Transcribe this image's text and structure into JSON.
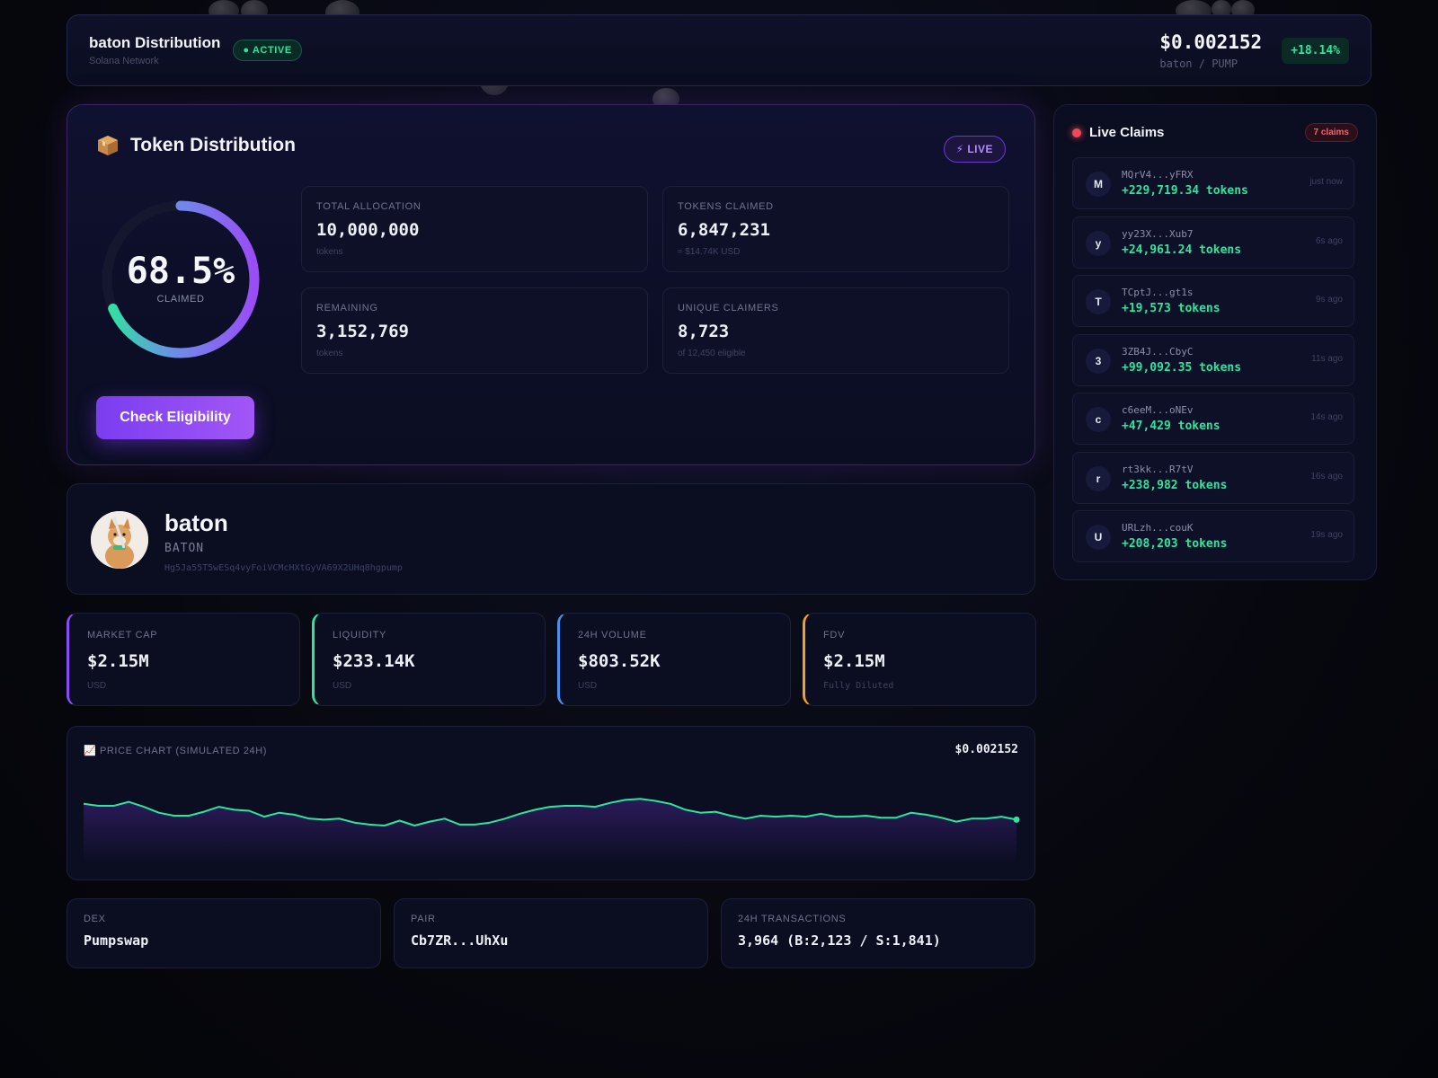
{
  "header": {
    "title": "baton Distribution",
    "network": "Solana Network",
    "status": "● ACTIVE",
    "price": "$0.002152",
    "pair": "baton / PUMP",
    "change": "+18.14%"
  },
  "distribution": {
    "title": "Token Distribution",
    "live_label": "⚡ LIVE",
    "claimed_pct": "68.5%",
    "claimed_fraction": 0.685,
    "claimed_label": "CLAIMED",
    "stats": [
      {
        "label": "TOTAL ALLOCATION",
        "value": "10,000,000",
        "sub": "tokens"
      },
      {
        "label": "TOKENS CLAIMED",
        "value": "6,847,231",
        "sub": "≈ $14.74K USD"
      },
      {
        "label": "REMAINING",
        "value": "3,152,769",
        "sub": "tokens"
      },
      {
        "label": "UNIQUE CLAIMERS",
        "value": "8,723",
        "sub": "of 12,450 eligible"
      }
    ],
    "cta_label": "Check Eligibility"
  },
  "profile": {
    "name": "baton",
    "ticker": "BATON",
    "address": "Hg5Ja55T5wESq4vyFoiVCMcHXtGyVA69X2UHq8hgpump"
  },
  "metrics": [
    {
      "label": "MARKET CAP",
      "value": "$2.15M",
      "sub": "USD",
      "color": "#8b4cf5"
    },
    {
      "label": "LIQUIDITY",
      "value": "$233.14K",
      "sub": "USD",
      "color": "#2ee59d"
    },
    {
      "label": "24H VOLUME",
      "value": "$803.52K",
      "sub": "USD",
      "color": "#4d8ff0"
    },
    {
      "label": "FDV",
      "value": "$2.15M",
      "sub": "Fully Diluted",
      "color": "#f0a22e"
    }
  ],
  "chart": {
    "title": "📈 PRICE CHART (SIMULATED 24H)",
    "price": "$0.002152"
  },
  "chart_data": {
    "type": "line",
    "title": "PRICE CHART (SIMULATED 24H)",
    "xlabel": "",
    "ylabel": "",
    "grid": false,
    "series": [
      {
        "color": "#2ee59d",
        "values": [
          0.62,
          0.6,
          0.6,
          0.64,
          0.59,
          0.53,
          0.5,
          0.5,
          0.54,
          0.59,
          0.56,
          0.55,
          0.49,
          0.53,
          0.51,
          0.47,
          0.46,
          0.47,
          0.43,
          0.41,
          0.4,
          0.45,
          0.4,
          0.44,
          0.47,
          0.41,
          0.41,
          0.43,
          0.47,
          0.52,
          0.56,
          0.59,
          0.6,
          0.6,
          0.59,
          0.63,
          0.66,
          0.67,
          0.65,
          0.62,
          0.56,
          0.53,
          0.54,
          0.5,
          0.47,
          0.5,
          0.49,
          0.5,
          0.49,
          0.52,
          0.49,
          0.49,
          0.5,
          0.48,
          0.48,
          0.53,
          0.51,
          0.48,
          0.44,
          0.47,
          0.47,
          0.49,
          0.46
        ]
      }
    ]
  },
  "info": [
    {
      "label": "DEX",
      "value": "Pumpswap"
    },
    {
      "label": "PAIR",
      "value": "Cb7ZR...UhXu"
    },
    {
      "label": "24H TRANSACTIONS",
      "value": "3,964 (B:2,123 / S:1,841)"
    }
  ],
  "claims": {
    "title": "Live Claims",
    "count": "7 claims",
    "items": [
      {
        "initial": "M",
        "address": "MQrV4...yFRX",
        "amount": "+229,719.34 tokens",
        "time": "just now"
      },
      {
        "initial": "y",
        "address": "yy23X...Xub7",
        "amount": "+24,961.24 tokens",
        "time": "6s ago"
      },
      {
        "initial": "T",
        "address": "TCptJ...gt1s",
        "amount": "+19,573 tokens",
        "time": "9s ago"
      },
      {
        "initial": "3",
        "address": "3ZB4J...CbyC",
        "amount": "+99,092.35 tokens",
        "time": "11s ago"
      },
      {
        "initial": "c",
        "address": "c6eeM...oNEv",
        "amount": "+47,429 tokens",
        "time": "14s ago"
      },
      {
        "initial": "r",
        "address": "rt3kk...R7tV",
        "amount": "+238,982 tokens",
        "time": "16s ago"
      },
      {
        "initial": "U",
        "address": "URLzh...couK",
        "amount": "+208,203 tokens",
        "time": "19s ago"
      }
    ]
  }
}
